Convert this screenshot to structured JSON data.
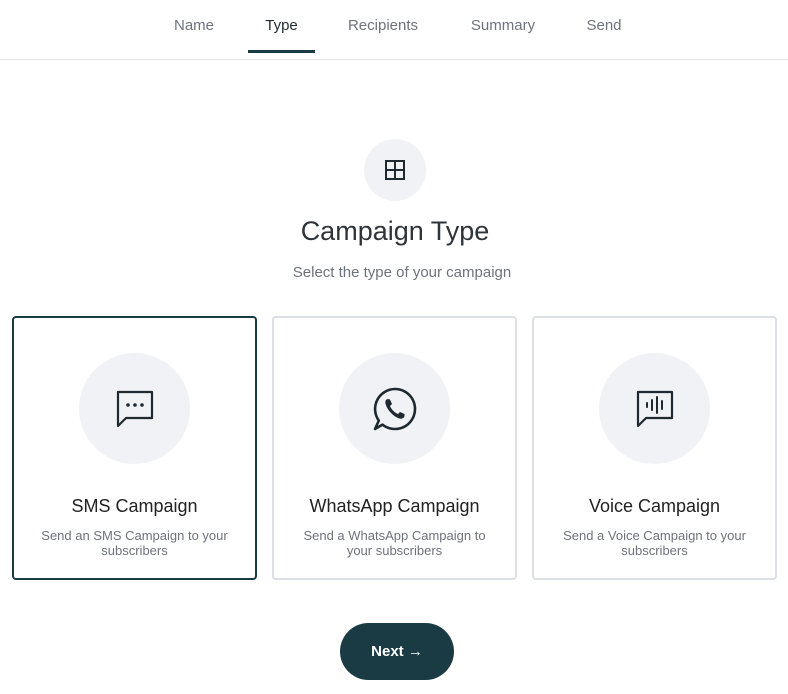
{
  "tabs": [
    {
      "label": "Name"
    },
    {
      "label": "Type"
    },
    {
      "label": "Recipients"
    },
    {
      "label": "Summary"
    },
    {
      "label": "Send"
    }
  ],
  "active_tab": "Type",
  "header": {
    "icon": "grid-icon",
    "title": "Campaign Type",
    "subtitle": "Select the type of your campaign"
  },
  "cards": [
    {
      "title": "SMS Campaign",
      "description": "Send an SMS Campaign to your subscribers",
      "icon": "message-dots-icon",
      "selected": true
    },
    {
      "title": "WhatsApp Campaign",
      "description": "Send a WhatsApp Campaign to your subscribers",
      "icon": "whatsapp-icon",
      "selected": false
    },
    {
      "title": "Voice Campaign",
      "description": "Send a Voice Campaign to your subscribers",
      "icon": "voice-message-icon",
      "selected": false
    }
  ],
  "next_button": {
    "label": "Next →"
  },
  "colors": {
    "accent": "#1a3a44",
    "card_border": "#dcdfe3",
    "icon_bg": "#f1f2f5",
    "muted_text": "#6e737a"
  }
}
